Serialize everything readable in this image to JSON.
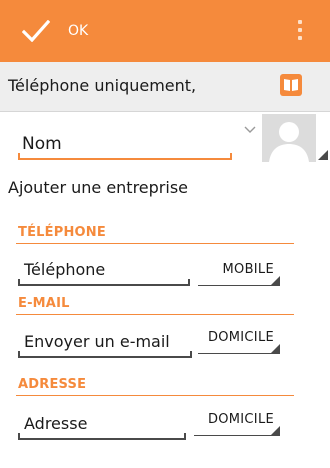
{
  "topbar": {
    "confirm_icon": "check-icon",
    "confirm_label": "OK",
    "menu_icon": "overflow-menu-icon",
    "accent_color": "#f58a3c"
  },
  "account": {
    "label": "Téléphone uniquement,",
    "icon": "contact-book-icon"
  },
  "name": {
    "value": "Nom",
    "expand_icon": "chevron-down-icon",
    "photo_icon": "contact-photo-icon"
  },
  "add_company": "Ajouter une entreprise",
  "phone": {
    "heading": "TÉLÉPHONE",
    "placeholder": "Téléphone",
    "type": "MOBILE"
  },
  "email": {
    "heading": "E-MAIL",
    "placeholder": "Envoyer un e-mail",
    "type": "DOMICILE"
  },
  "address": {
    "heading": "ADRESSE",
    "placeholder": "Adresse",
    "type": "DOMICILE"
  }
}
